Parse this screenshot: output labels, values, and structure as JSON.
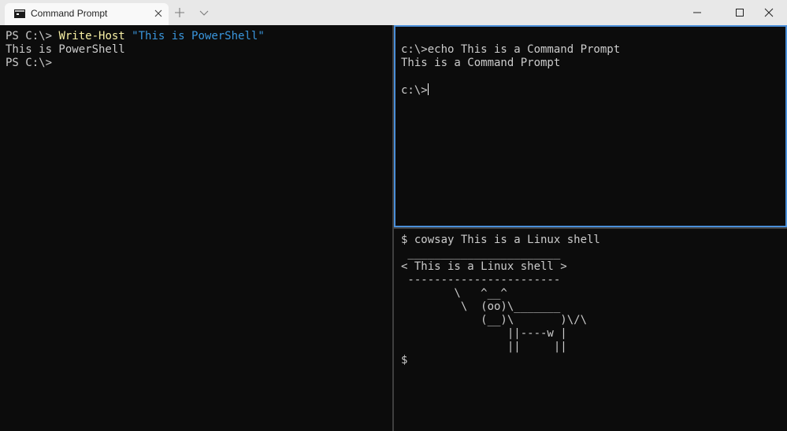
{
  "window": {
    "tab_title": "Command Prompt"
  },
  "icons": {
    "tab_icon": "command-prompt-icon",
    "tab_close": "close-icon",
    "new_tab": "plus-icon",
    "dropdown": "chevron-down-icon",
    "minimize": "minimize-icon",
    "maximize": "maximize-icon",
    "close": "close-icon"
  },
  "colors": {
    "terminal_bg": "#0c0c0c",
    "terminal_text": "#cccccc",
    "ps_command": "#f9f1a5",
    "ps_string": "#3a96dd",
    "focused_border": "#4a8fd9",
    "titlebar_bg": "#e8e8e8"
  },
  "panes": {
    "powershell": {
      "prompt_1": "PS C:\\> ",
      "command": "Write-Host",
      "space": " ",
      "argument": "\"This is PowerShell\"",
      "output_1": "This is PowerShell",
      "prompt_2": "PS C:\\>"
    },
    "cmd": {
      "line_1": "c:\\>echo This is a Command Prompt",
      "line_2": "This is a Command Prompt",
      "line_3": "",
      "line_4": "c:\\>"
    },
    "linux": {
      "line_1": "$ cowsay This is a Linux shell",
      "line_2": " _______________________",
      "line_3": "< This is a Linux shell >",
      "line_4": " -----------------------",
      "line_5": "        \\   ^__^",
      "line_6": "         \\  (oo)\\_______",
      "line_7": "            (__)\\       )\\/\\",
      "line_8": "                ||----w |",
      "line_9": "                ||     ||",
      "line_10": "$"
    }
  }
}
